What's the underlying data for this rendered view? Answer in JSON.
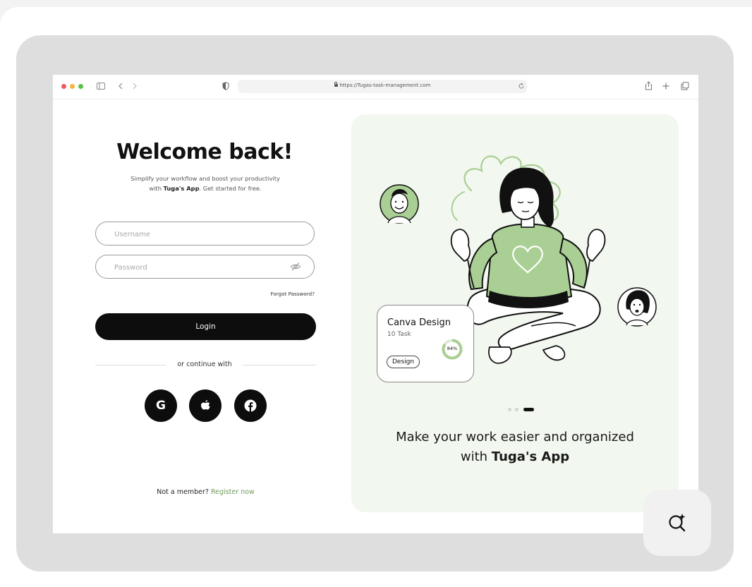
{
  "browser": {
    "url": "https://Tugas-task-management.com",
    "icons": [
      "sidebar-icon",
      "back-icon",
      "forward-icon",
      "shield-icon",
      "lock-icon",
      "reload-icon",
      "share-icon",
      "new-tab-icon",
      "tabs-icon"
    ]
  },
  "login": {
    "title": "Welcome back!",
    "subtitle_line1": "Simplify your workflow and boost your productivity",
    "subtitle_prefix": "with",
    "subtitle_brand": "Tuga's App",
    "subtitle_suffix": ". Get started for free.",
    "username_placeholder": "Username",
    "password_placeholder": "Password",
    "forgot_password": "Forgot Password?",
    "login_button": "Login",
    "divider_text": "or continue with",
    "social_buttons": [
      "google",
      "apple",
      "facebook"
    ],
    "google_letter": "G",
    "register_prompt": "Not a member?",
    "register_link": "Register now"
  },
  "promo": {
    "card_title": "Canva Design",
    "card_count": "10 Task",
    "card_progress": "84%",
    "card_progress_value": 0.84,
    "card_tag": "Design",
    "pager_active": 3,
    "pager_total": 3,
    "tagline_line1": "Make your work easier and organized",
    "tagline_prefix": "with",
    "tagline_brand": "Tuga's App"
  },
  "colors": {
    "accent_green": "#a9cf94",
    "link_green": "#6f9a5b",
    "panel_bg": "#f2f7ef",
    "button_dark": "#0d0d0d"
  },
  "assist_button": {
    "icon": "sparkle-search-icon"
  }
}
